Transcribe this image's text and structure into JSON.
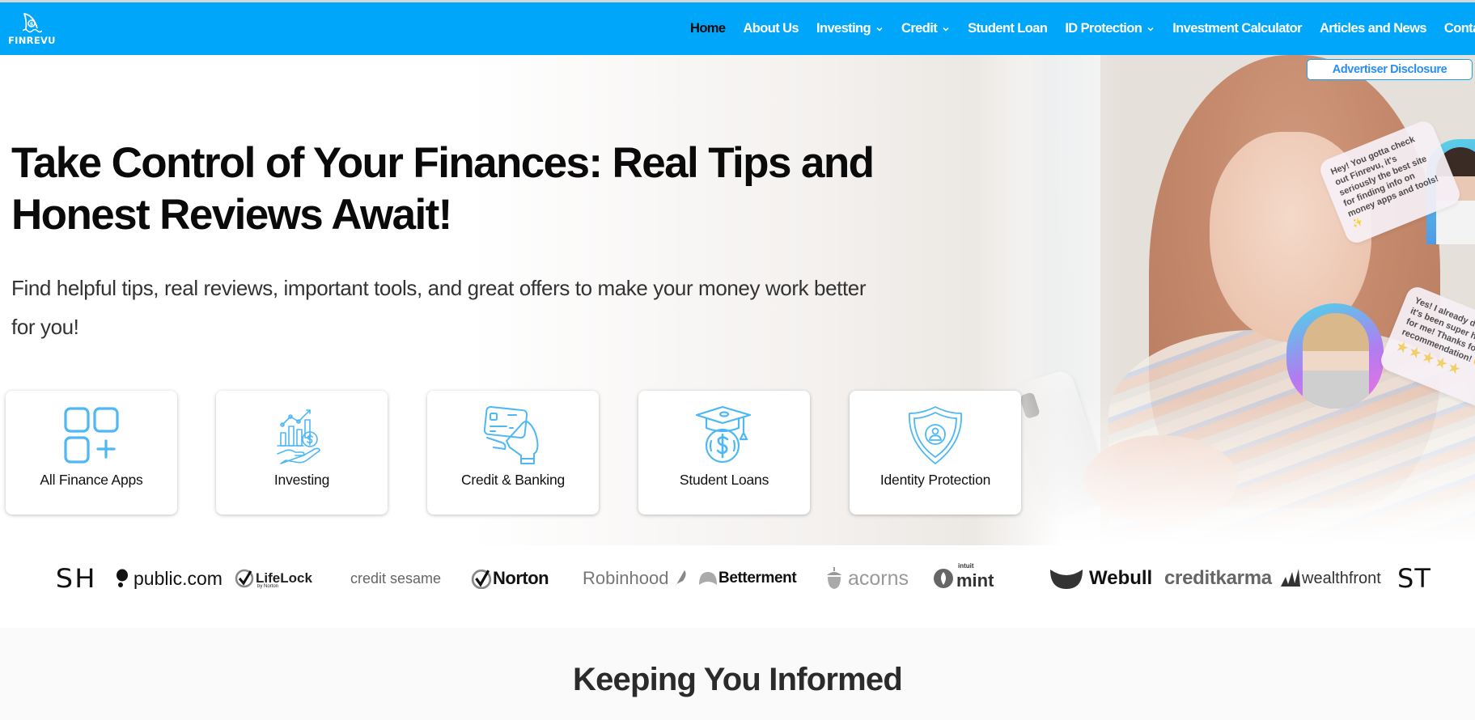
{
  "brand": {
    "name": "FINREVU",
    "accent_color": "#00A6FA",
    "icon_color": "#4DB8F5"
  },
  "nav": {
    "items": [
      {
        "label": "Home",
        "active": true,
        "has_dropdown": false
      },
      {
        "label": "About Us",
        "active": false,
        "has_dropdown": false
      },
      {
        "label": "Investing",
        "active": false,
        "has_dropdown": true
      },
      {
        "label": "Credit",
        "active": false,
        "has_dropdown": true
      },
      {
        "label": "Student Loan",
        "active": false,
        "has_dropdown": false
      },
      {
        "label": "ID Protection",
        "active": false,
        "has_dropdown": true
      },
      {
        "label": "Investment Calculator",
        "active": false,
        "has_dropdown": false
      },
      {
        "label": "Articles and News",
        "active": false,
        "has_dropdown": false
      },
      {
        "label": "Contact",
        "active": false,
        "has_dropdown": false
      }
    ]
  },
  "advertiser_disclosure": "Advertiser Disclosure",
  "hero": {
    "title": "Take Control of Your Finances: Real Tips and Honest Reviews Await!",
    "subtitle": "Find helpful tips, real reviews, important tools, and great offers to make your money work better for you!",
    "bubbles": [
      {
        "text": "Hey! You gotta check out Finrevu, it's seriously the best site for finding info on money apps and tools!✨"
      },
      {
        "text": "Yes! I already did, and it's been super helpful for me! Thanks for the recommendation! 🙂",
        "stars": 5
      }
    ]
  },
  "categories": [
    {
      "label": "All Finance Apps",
      "icon": "apps-grid-icon"
    },
    {
      "label": "Investing",
      "icon": "investing-hand-chart-icon"
    },
    {
      "label": "Credit & Banking",
      "icon": "credit-card-hand-icon"
    },
    {
      "label": "Student Loans",
      "icon": "graduation-cap-money-icon"
    },
    {
      "label": "Identity Protection",
      "icon": "shield-user-icon"
    }
  ],
  "partner_logos": [
    "SH",
    "public.com",
    "LifeLock",
    "credit sesame",
    "Norton",
    "Robinhood",
    "Betterment",
    "acorns",
    "mint",
    "Webull",
    "creditkarma",
    "wealthfront",
    "ST"
  ],
  "partner_logo_extras": {
    "lifelock_sub": "by Norton",
    "mint_sub": "intuit"
  },
  "section2": {
    "title": "Keeping You Informed"
  }
}
